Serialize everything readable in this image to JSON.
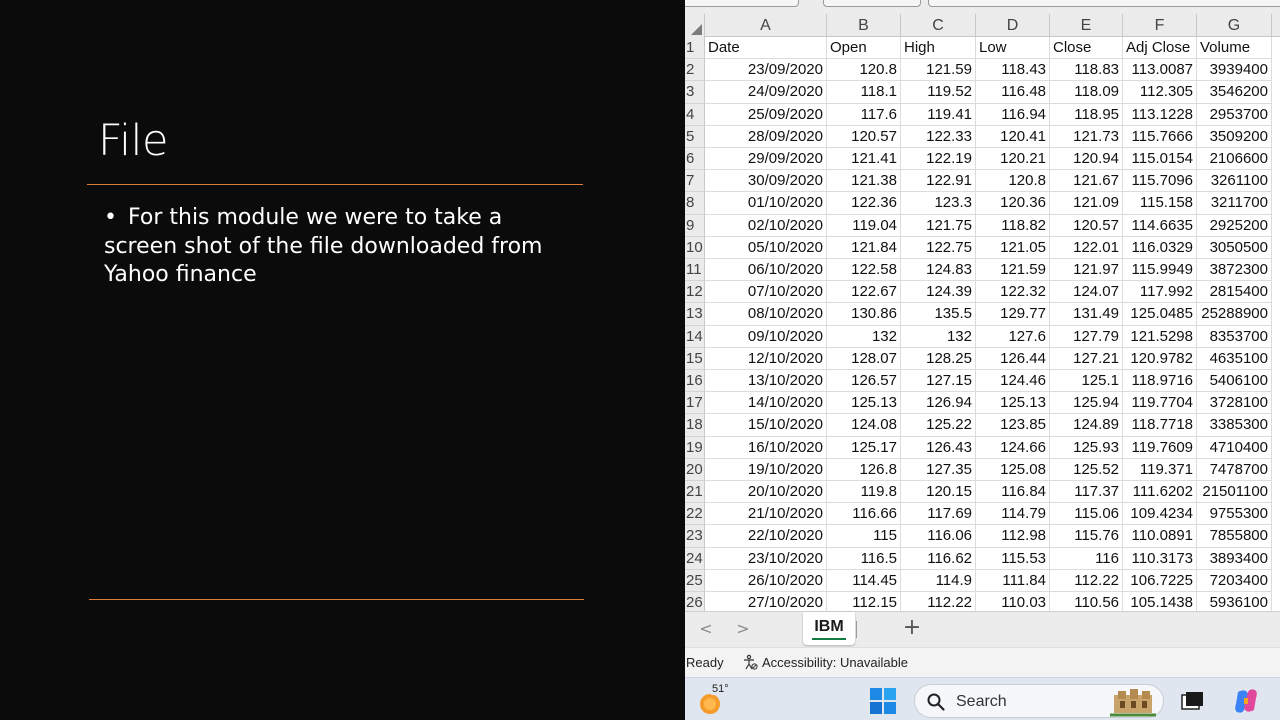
{
  "slide": {
    "title": "File",
    "bullet_marker": "•",
    "bullet": "For this module we were to take a screen shot of the file downloaded from Yahoo finance"
  },
  "excel": {
    "column_letters": [
      "A",
      "B",
      "C",
      "D",
      "E",
      "F",
      "G"
    ],
    "row_numbers": [
      "1",
      "2",
      "3",
      "4",
      "5",
      "6",
      "7",
      "8",
      "9",
      "10",
      "11",
      "12",
      "13",
      "14",
      "15",
      "16",
      "17",
      "18",
      "19",
      "20",
      "21",
      "22",
      "23",
      "24",
      "25",
      "26"
    ],
    "headers": [
      "Date",
      "Open",
      "High",
      "Low",
      "Close",
      "Adj Close",
      "Volume"
    ],
    "rows": [
      [
        "23/09/2020",
        "120.8",
        "121.59",
        "118.43",
        "118.83",
        "113.0087",
        "3939400"
      ],
      [
        "24/09/2020",
        "118.1",
        "119.52",
        "116.48",
        "118.09",
        "112.305",
        "3546200"
      ],
      [
        "25/09/2020",
        "117.6",
        "119.41",
        "116.94",
        "118.95",
        "113.1228",
        "2953700"
      ],
      [
        "28/09/2020",
        "120.57",
        "122.33",
        "120.41",
        "121.73",
        "115.7666",
        "3509200"
      ],
      [
        "29/09/2020",
        "121.41",
        "122.19",
        "120.21",
        "120.94",
        "115.0154",
        "2106600"
      ],
      [
        "30/09/2020",
        "121.38",
        "122.91",
        "120.8",
        "121.67",
        "115.7096",
        "3261100"
      ],
      [
        "01/10/2020",
        "122.36",
        "123.3",
        "120.36",
        "121.09",
        "115.158",
        "3211700"
      ],
      [
        "02/10/2020",
        "119.04",
        "121.75",
        "118.82",
        "120.57",
        "114.6635",
        "2925200"
      ],
      [
        "05/10/2020",
        "121.84",
        "122.75",
        "121.05",
        "122.01",
        "116.0329",
        "3050500"
      ],
      [
        "06/10/2020",
        "122.58",
        "124.83",
        "121.59",
        "121.97",
        "115.9949",
        "3872300"
      ],
      [
        "07/10/2020",
        "122.67",
        "124.39",
        "122.32",
        "124.07",
        "117.992",
        "2815400"
      ],
      [
        "08/10/2020",
        "130.86",
        "135.5",
        "129.77",
        "131.49",
        "125.0485",
        "25288900"
      ],
      [
        "09/10/2020",
        "132",
        "132",
        "127.6",
        "127.79",
        "121.5298",
        "8353700"
      ],
      [
        "12/10/2020",
        "128.07",
        "128.25",
        "126.44",
        "127.21",
        "120.9782",
        "4635100"
      ],
      [
        "13/10/2020",
        "126.57",
        "127.15",
        "124.46",
        "125.1",
        "118.9716",
        "5406100"
      ],
      [
        "14/10/2020",
        "125.13",
        "126.94",
        "125.13",
        "125.94",
        "119.7704",
        "3728100"
      ],
      [
        "15/10/2020",
        "124.08",
        "125.22",
        "123.85",
        "124.89",
        "118.7718",
        "3385300"
      ],
      [
        "16/10/2020",
        "125.17",
        "126.43",
        "124.66",
        "125.93",
        "119.7609",
        "4710400"
      ],
      [
        "19/10/2020",
        "126.8",
        "127.35",
        "125.08",
        "125.52",
        "119.371",
        "7478700"
      ],
      [
        "20/10/2020",
        "119.8",
        "120.15",
        "116.84",
        "117.37",
        "111.6202",
        "21501100"
      ],
      [
        "21/10/2020",
        "116.66",
        "117.69",
        "114.79",
        "115.06",
        "109.4234",
        "9755300"
      ],
      [
        "22/10/2020",
        "115",
        "116.06",
        "112.98",
        "115.76",
        "110.0891",
        "7855800"
      ],
      [
        "23/10/2020",
        "116.5",
        "116.62",
        "115.53",
        "116",
        "110.3173",
        "3893400"
      ],
      [
        "26/10/2020",
        "114.45",
        "114.9",
        "111.84",
        "112.22",
        "106.7225",
        "7203400"
      ],
      [
        "27/10/2020",
        "112.15",
        "112.22",
        "110.03",
        "110.56",
        "105.1438",
        "5936100"
      ]
    ],
    "sheet_tab": "IBM",
    "nav_prev": "<",
    "nav_next": ">",
    "add_sheet": "+",
    "status_ready": "Ready",
    "status_accessibility": "Accessibility: Unavailable"
  },
  "taskbar": {
    "temperature": "51°",
    "search_placeholder": "Search"
  },
  "colors": {
    "slide_bg": "#0c0b0b",
    "accent_rule": "#d97d3c",
    "excel_green": "#107c41"
  }
}
